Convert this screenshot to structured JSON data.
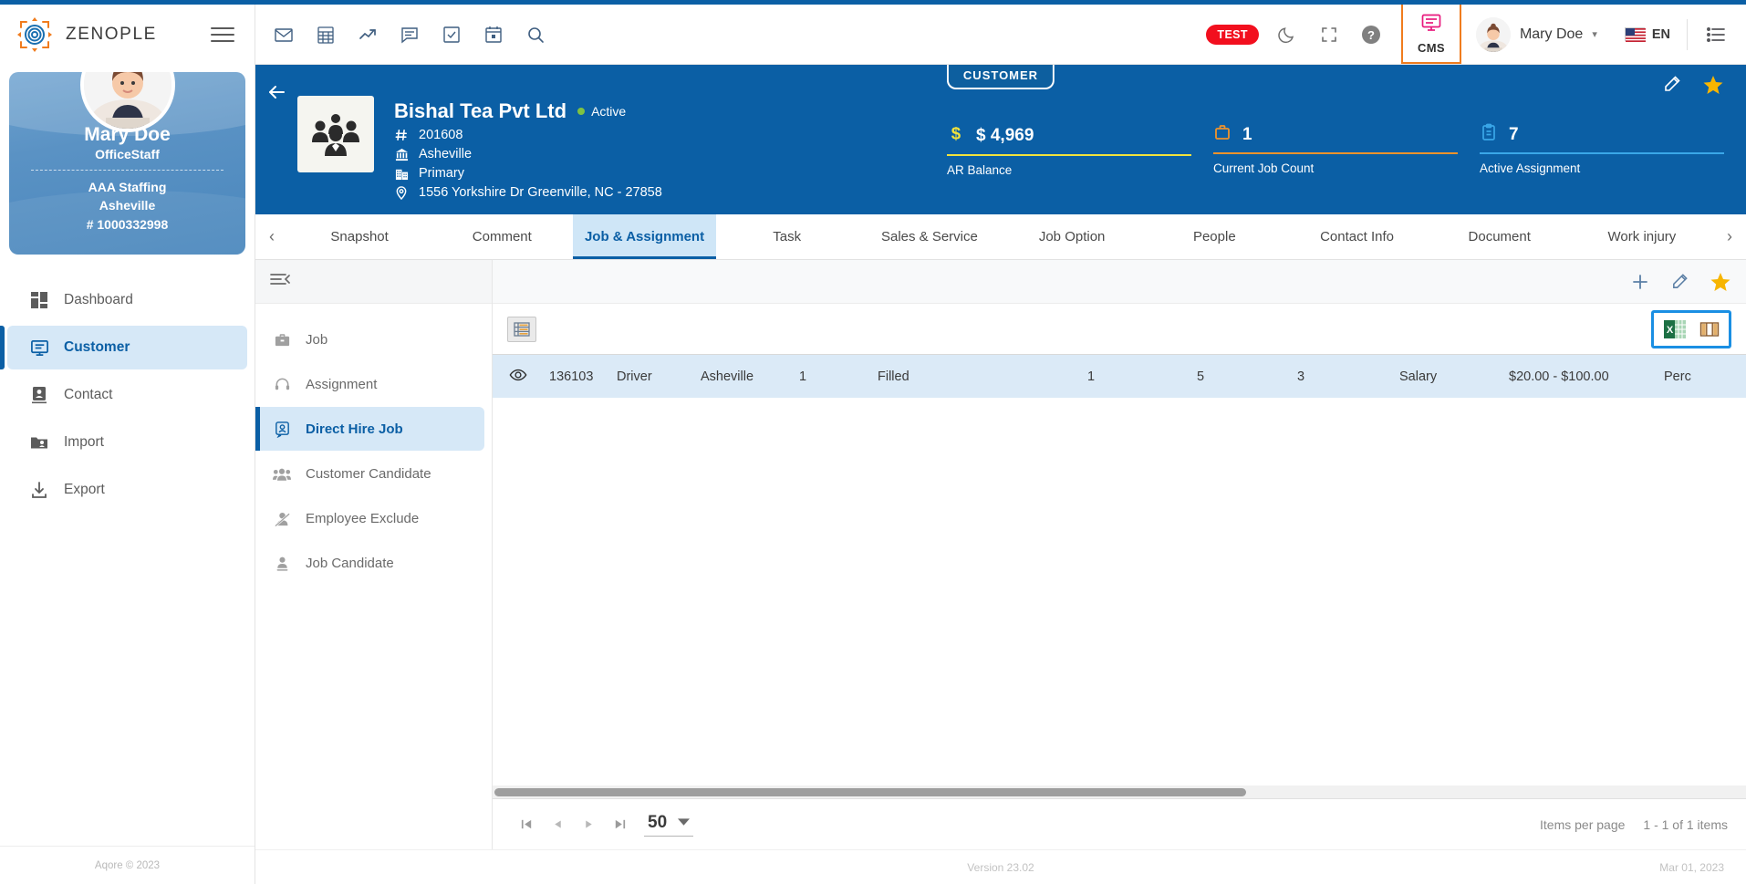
{
  "brand": {
    "name": "ZENOPLE",
    "logo_icon": "zenople-target-icon",
    "menu_icon": "hamburger-icon"
  },
  "profile": {
    "name": "Mary Doe",
    "role": "OfficeStaff",
    "org": "AAA Staffing",
    "branch": "Asheville",
    "number": "# 1000332998",
    "avatar_icon": "user-avatar"
  },
  "sidebar": {
    "items": [
      {
        "label": "Dashboard",
        "icon": "dashboard-grid-icon",
        "active": false
      },
      {
        "label": "Customer",
        "icon": "customer-card-icon",
        "active": true
      },
      {
        "label": "Contact",
        "icon": "contact-badge-icon",
        "active": false
      },
      {
        "label": "Import",
        "icon": "import-folder-icon",
        "active": false
      },
      {
        "label": "Export",
        "icon": "export-download-icon",
        "active": false
      }
    ]
  },
  "topbar": {
    "left_icons": [
      {
        "name": "mail-icon"
      },
      {
        "name": "calculator-icon"
      },
      {
        "name": "trending-up-icon"
      },
      {
        "name": "message-icon"
      },
      {
        "name": "checkbox-task-icon"
      },
      {
        "name": "calendar-icon"
      },
      {
        "name": "search-icon"
      }
    ],
    "test_badge": "TEST",
    "dark_mode_icon": "moon-icon",
    "fullscreen_icon": "fullscreen-icon",
    "help_icon": "help-circle-icon",
    "cms_label": "CMS",
    "cms_icon": "cms-screen-icon",
    "user_name": "Mary Doe",
    "user_caret_icon": "chevron-down-icon",
    "language": "EN",
    "flag_icon": "us-flag-icon",
    "list_icon": "list-menu-icon"
  },
  "banner": {
    "badge": "CUSTOMER",
    "back_icon": "back-arrow-icon",
    "logo_icon": "people-group-icon",
    "title": "Bishal Tea Pvt Ltd",
    "status": "Active",
    "id": "201608",
    "id_icon": "hash-icon",
    "branch": "Asheville",
    "branch_icon": "bank-icon",
    "department": "Primary",
    "department_icon": "building-icon",
    "address": "1556 Yorkshire Dr Greenville, NC - 27858",
    "address_icon": "location-pin-icon",
    "edit_icon": "pencil-icon",
    "favorite_icon": "star-icon",
    "stats": [
      {
        "icon": "dollar-icon",
        "value": "$ 4,969",
        "label": "AR Balance",
        "color": "#f2e33c"
      },
      {
        "icon": "briefcase-icon",
        "value": "1",
        "label": "Current Job Count",
        "color": "#f0932b"
      },
      {
        "icon": "clipboard-icon",
        "value": "7",
        "label": "Active Assignment",
        "color": "#3aa7e8"
      }
    ]
  },
  "tabs": {
    "prev_icon": "chevron-left-icon",
    "next_icon": "chevron-right-icon",
    "items": [
      {
        "label": "Snapshot",
        "active": false
      },
      {
        "label": "Comment",
        "active": false
      },
      {
        "label": "Job & Assignment",
        "active": true
      },
      {
        "label": "Task",
        "active": false
      },
      {
        "label": "Sales & Service",
        "active": false
      },
      {
        "label": "Job Option",
        "active": false
      },
      {
        "label": "People",
        "active": false
      },
      {
        "label": "Contact Info",
        "active": false
      },
      {
        "label": "Document",
        "active": false
      },
      {
        "label": "Work injury",
        "active": false
      }
    ]
  },
  "subnav": {
    "collapse_icon": "collapse-panel-icon",
    "items": [
      {
        "label": "Job",
        "icon": "briefcase-icon",
        "active": false
      },
      {
        "label": "Assignment",
        "icon": "headset-icon",
        "active": false
      },
      {
        "label": "Direct Hire Job",
        "icon": "id-card-icon",
        "active": true
      },
      {
        "label": "Customer Candidate",
        "icon": "people-icon",
        "active": false
      },
      {
        "label": "Employee Exclude",
        "icon": "person-block-icon",
        "active": false
      },
      {
        "label": "Job Candidate",
        "icon": "person-icon",
        "active": false
      }
    ]
  },
  "content_actions": {
    "add_icon": "plus-icon",
    "edit_icon": "pencil-icon",
    "favorite_icon": "star-icon"
  },
  "grid_toolbar": {
    "view_toggle_icon": "list-view-icon",
    "excel_icon": "excel-export-icon",
    "columns_icon": "column-chooser-icon"
  },
  "table": {
    "rows": [
      {
        "eye_icon": "eye-icon",
        "id": "136103",
        "title": "Driver",
        "branch": "Asheville",
        "n1": "1",
        "status": "Filled",
        "n2": "1",
        "n3": "5",
        "n4": "3",
        "pay_type": "Salary",
        "pay_range": "$20.00 - $100.00",
        "last": "Perc"
      }
    ]
  },
  "pager": {
    "first_icon": "page-first-icon",
    "prev_icon": "page-prev-icon",
    "next_icon": "page-next-icon",
    "last_icon": "page-last-icon",
    "page_size": "50",
    "page_size_caret": "chevron-down-icon",
    "items_per_page_label": "Items per page",
    "range_label": "1 - 1 of 1 items"
  },
  "statusbar": {
    "copyright": "Aqore © 2023",
    "version": "Version 23.02",
    "date": "Mar 01, 2023"
  }
}
